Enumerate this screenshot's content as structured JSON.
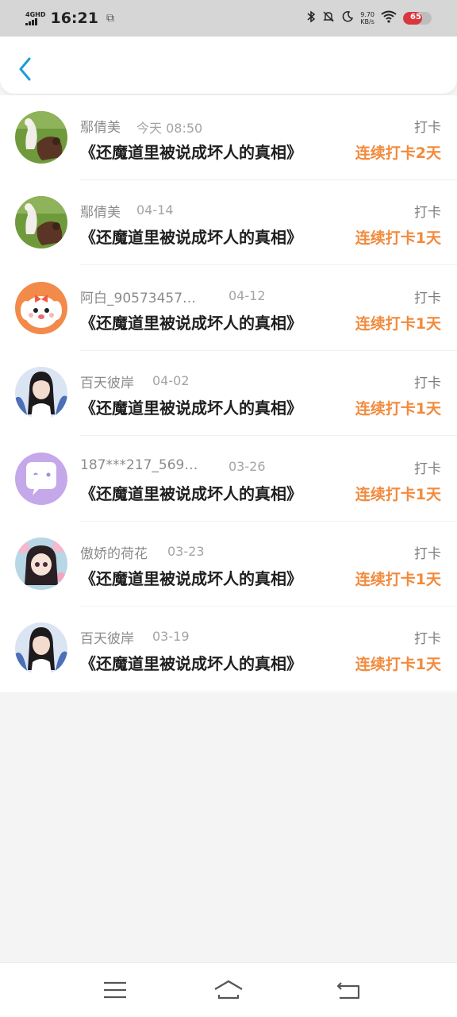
{
  "status_bar": {
    "network": "4GHD",
    "time": "16:21",
    "speed_value": "9.70",
    "speed_unit": "KB/s",
    "battery": "65",
    "icons": [
      "bluetooth-icon",
      "mute-icon",
      "moon-icon",
      "wifi-icon"
    ]
  },
  "header": {
    "back_icon": "chevron-left-icon",
    "accent": "#1e9bd8"
  },
  "list": {
    "action_color": "#7d7d7d",
    "streak_color": "#f28a3c",
    "items": [
      {
        "user": "鄢倩美",
        "date": "今天 08:50",
        "title": "《还魔道里被说成坏人的真相》",
        "action": "打卡",
        "streak": "连续打卡2天",
        "avatar": "alpaca"
      },
      {
        "user": "鄢倩美",
        "date": "04-14",
        "title": "《还魔道里被说成坏人的真相》",
        "action": "打卡",
        "streak": "连续打卡1天",
        "avatar": "alpaca"
      },
      {
        "user": "阿白_90573457…",
        "date": "04-12",
        "title": "《还魔道里被说成坏人的真相》",
        "action": "打卡",
        "streak": "连续打卡1天",
        "avatar": "puppy"
      },
      {
        "user": "百天彼岸",
        "date": "04-02",
        "title": "《还魔道里被说成坏人的真相》",
        "action": "打卡",
        "streak": "连续打卡1天",
        "avatar": "girl"
      },
      {
        "user": "187***217_569…",
        "date": "03-26",
        "title": "《还魔道里被说成坏人的真相》",
        "action": "打卡",
        "streak": "连续打卡1天",
        "avatar": "chat"
      },
      {
        "user": "傲娇的荷花",
        "date": "03-23",
        "title": "《还魔道里被说成坏人的真相》",
        "action": "打卡",
        "streak": "连续打卡1天",
        "avatar": "anime"
      },
      {
        "user": "百天彼岸",
        "date": "03-19",
        "title": "《还魔道里被说成坏人的真相》",
        "action": "打卡",
        "streak": "连续打卡1天",
        "avatar": "girl"
      }
    ]
  },
  "nav_bar": {
    "buttons": [
      "menu-icon",
      "home-icon",
      "back-icon"
    ]
  }
}
